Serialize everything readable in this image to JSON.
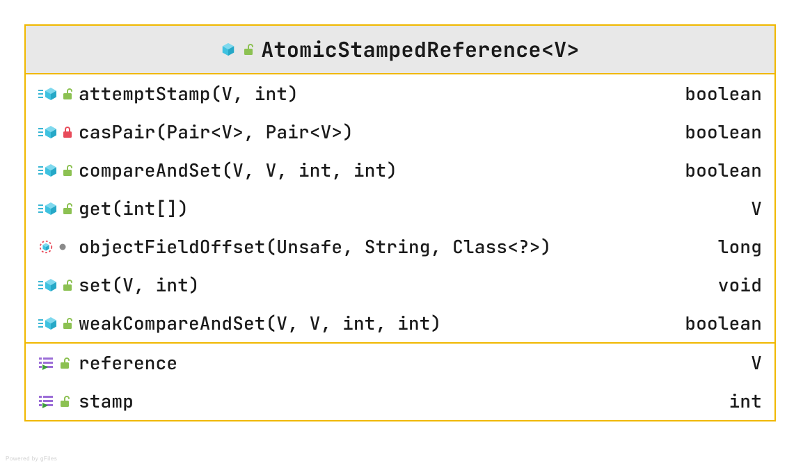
{
  "header": {
    "title": "AtomicStampedReference<V>"
  },
  "methods": [
    {
      "name": "attemptStamp(V, int)",
      "type": "boolean",
      "icon": "method",
      "access": "public"
    },
    {
      "name": "casPair(Pair<V>, Pair<V>)",
      "type": "boolean",
      "icon": "method",
      "access": "private"
    },
    {
      "name": "compareAndSet(V, V, int, int)",
      "type": "boolean",
      "icon": "method",
      "access": "public"
    },
    {
      "name": "get(int[])",
      "type": "V",
      "icon": "method",
      "access": "public"
    },
    {
      "name": "objectFieldOffset(Unsafe, String, Class<?>)",
      "type": "long",
      "icon": "dotted",
      "access": "package"
    },
    {
      "name": "set(V, int)",
      "type": "void",
      "icon": "method",
      "access": "public"
    },
    {
      "name": "weakCompareAndSet(V, V, int, int)",
      "type": "boolean",
      "icon": "method",
      "access": "public"
    }
  ],
  "fields": [
    {
      "name": "reference",
      "type": "V",
      "icon": "field",
      "access": "public"
    },
    {
      "name": "stamp",
      "type": "int",
      "icon": "field",
      "access": "public"
    }
  ],
  "watermark": "Powered by gFiles"
}
